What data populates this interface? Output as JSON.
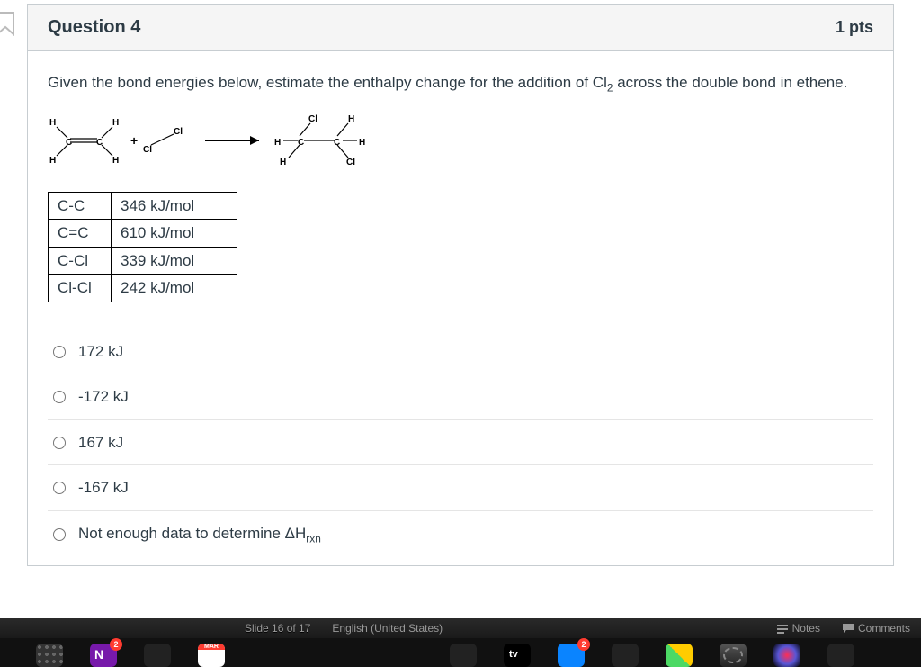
{
  "question": {
    "title": "Question 4",
    "points": "1 pts",
    "prompt_html": "Given the bond energies below, estimate the enthalpy change for the addition of Cl<sub>2</sub> across the double bond in ethene."
  },
  "bond_table": [
    {
      "bond": "C-C",
      "energy": "346 kJ/mol"
    },
    {
      "bond": "C=C",
      "energy": "610 kJ/mol"
    },
    {
      "bond": "C-Cl",
      "energy": "339 kJ/mol"
    },
    {
      "bond": "Cl-Cl",
      "energy": "242 kJ/mol"
    }
  ],
  "answers": [
    {
      "label_html": "172 kJ"
    },
    {
      "label_html": "-172 kJ"
    },
    {
      "label_html": "167 kJ"
    },
    {
      "label_html": "-167 kJ"
    },
    {
      "label_html": "Not enough data to determine ΔH<sub>rxn</sub>"
    }
  ],
  "statusbar": {
    "slide": "Slide 16 of 17",
    "lang": "English (United States)",
    "notes": "Notes",
    "comments": "Comments"
  },
  "dock": {
    "cal_label": "MAR",
    "badge_a": "2",
    "badge_b": "2"
  }
}
